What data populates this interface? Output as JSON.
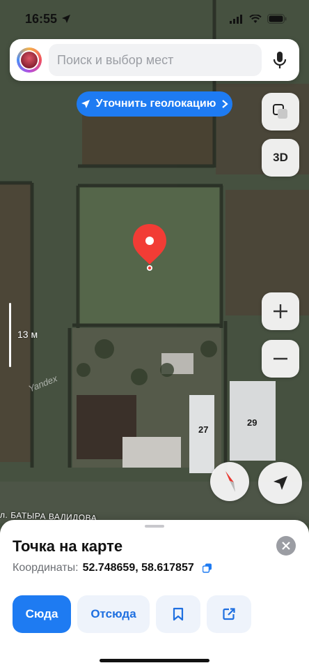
{
  "status_bar": {
    "time": "16:55"
  },
  "search": {
    "placeholder": "Поиск и выбор мест"
  },
  "geo_button": {
    "label": "Уточнить геолокацию"
  },
  "map": {
    "scale_label": "13 м",
    "watermark": "Yandex",
    "house_numbers": [
      "27",
      "29"
    ],
    "street_label": "л. БАТЫРА ВАЛИДОВА",
    "view_toggle_3d": "3D"
  },
  "sheet": {
    "title": "Точка на карте",
    "coords_label": "Координаты:",
    "coords_value": "52.748659, 58.617857",
    "actions": {
      "to_here": "Сюда",
      "from_here": "Отсюда"
    }
  },
  "colors": {
    "accent": "#1E7BF2",
    "pin": "#F23C35",
    "sheet_secondary_bg": "#EEF3FB"
  }
}
